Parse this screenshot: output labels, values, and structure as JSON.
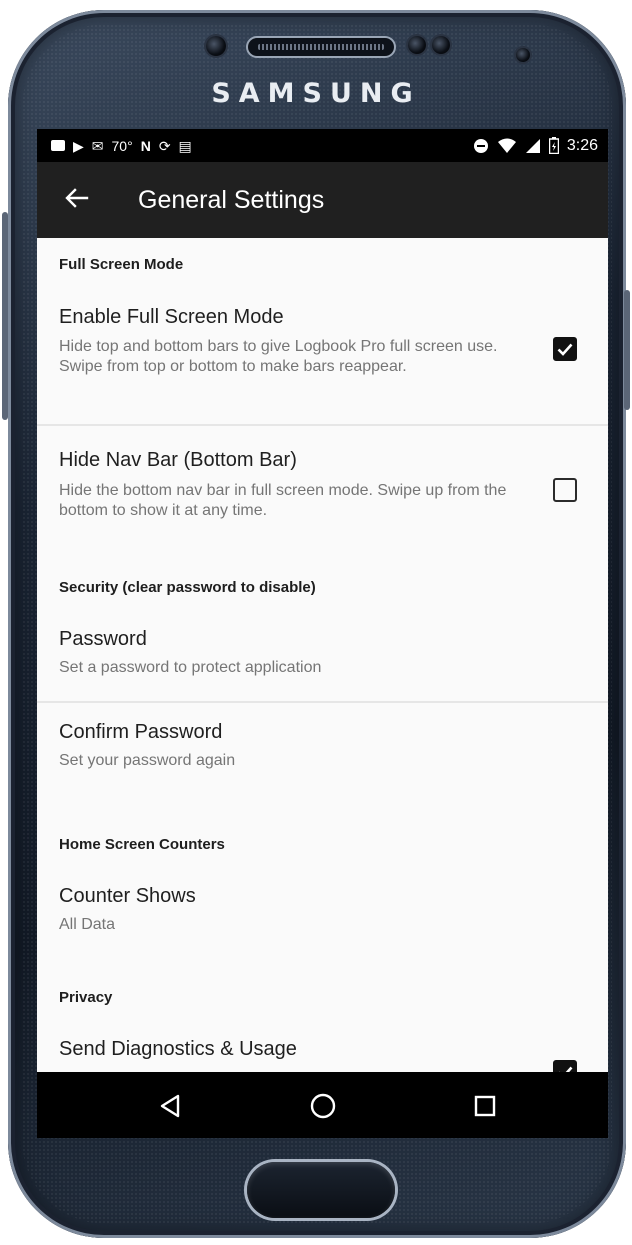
{
  "device": {
    "brand": "SAMSUNG"
  },
  "status_bar": {
    "temperature": "70°",
    "time": "3:26",
    "icons": [
      "notification-icon",
      "play-store-icon",
      "email-icon",
      "nfc-icon",
      "sync-icon",
      "clipboard-icon",
      "do-not-disturb-icon",
      "wifi-icon",
      "signal-icon",
      "battery-icon"
    ]
  },
  "app_bar": {
    "title": "General Settings",
    "back_icon": "arrow-left-icon"
  },
  "sections": {
    "full_screen": {
      "header": "Full Screen Mode",
      "enable_full_screen": {
        "title": "Enable Full Screen Mode",
        "summary": "Hide top and bottom bars to give Logbook Pro full screen use. Swipe from top or bottom to make bars reappear.",
        "checked": true
      },
      "hide_nav_bar": {
        "title": "Hide Nav Bar (Bottom Bar)",
        "summary": "Hide the bottom nav bar in full screen mode. Swipe up from the bottom to show it at any time.",
        "checked": false
      }
    },
    "security": {
      "header": "Security (clear password to disable)",
      "password": {
        "title": "Password",
        "summary": "Set a password to protect application"
      },
      "confirm_password": {
        "title": "Confirm Password",
        "summary": "Set your password again"
      }
    },
    "home_counters": {
      "header": "Home Screen Counters",
      "counter_shows": {
        "title": "Counter Shows",
        "summary": "All Data"
      }
    },
    "privacy": {
      "header": "Privacy",
      "send_diagnostics": {
        "title": "Send Diagnostics & Usage",
        "checked": true
      }
    }
  },
  "nav_bar": {
    "back": "triangle-back-icon",
    "home": "circle-home-icon",
    "recents": "square-recents-icon"
  }
}
